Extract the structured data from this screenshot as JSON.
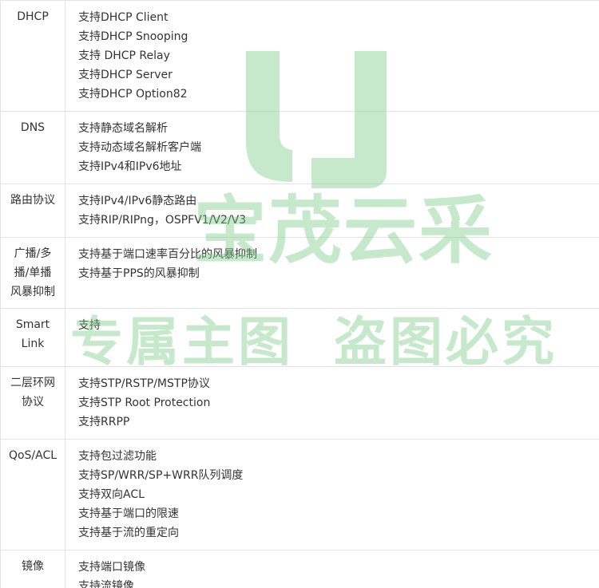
{
  "rows": [
    {
      "label": "DHCP",
      "items": [
        "支持DHCP Client",
        "支持DHCP Snooping",
        "支持 DHCP Relay",
        "支持DHCP Server",
        "支持DHCP Option82"
      ]
    },
    {
      "label": "DNS",
      "items": [
        "支持静态域名解析",
        "支持动态域名解析客户端",
        "支持IPv4和IPv6地址"
      ]
    },
    {
      "label": "路由协议",
      "items": [
        "支持IPv4/IPv6静态路由",
        "支持RIP/RIPng，OSPFV1/V2/V3"
      ]
    },
    {
      "label": "广播/多\n播/单播\n风暴抑制",
      "items": [
        "支持基于端口速率百分比的风暴抑制",
        "支持基于PPS的风暴抑制"
      ]
    },
    {
      "label": "Smart\nLink",
      "items": [
        "支持"
      ]
    },
    {
      "label": "二层环网\n协议",
      "items": [
        "支持STP/RSTP/MSTP协议",
        "支持STP Root Protection",
        "支持RRPP"
      ]
    },
    {
      "label": "QoS/ACL",
      "items": [
        "支持包过滤功能",
        "支持SP/WRR/SP+WRR队列调度",
        "支持双向ACL",
        "支持基于端口的限速",
        "支持基于流的重定向"
      ]
    },
    {
      "label": "镜像",
      "items": [
        "支持端口镜像",
        "支持流镜像"
      ]
    }
  ],
  "watermark": {
    "brand": "宝茂云采",
    "line_left": "专属主图",
    "line_right": "盗图必究",
    "color": "#78c882"
  }
}
